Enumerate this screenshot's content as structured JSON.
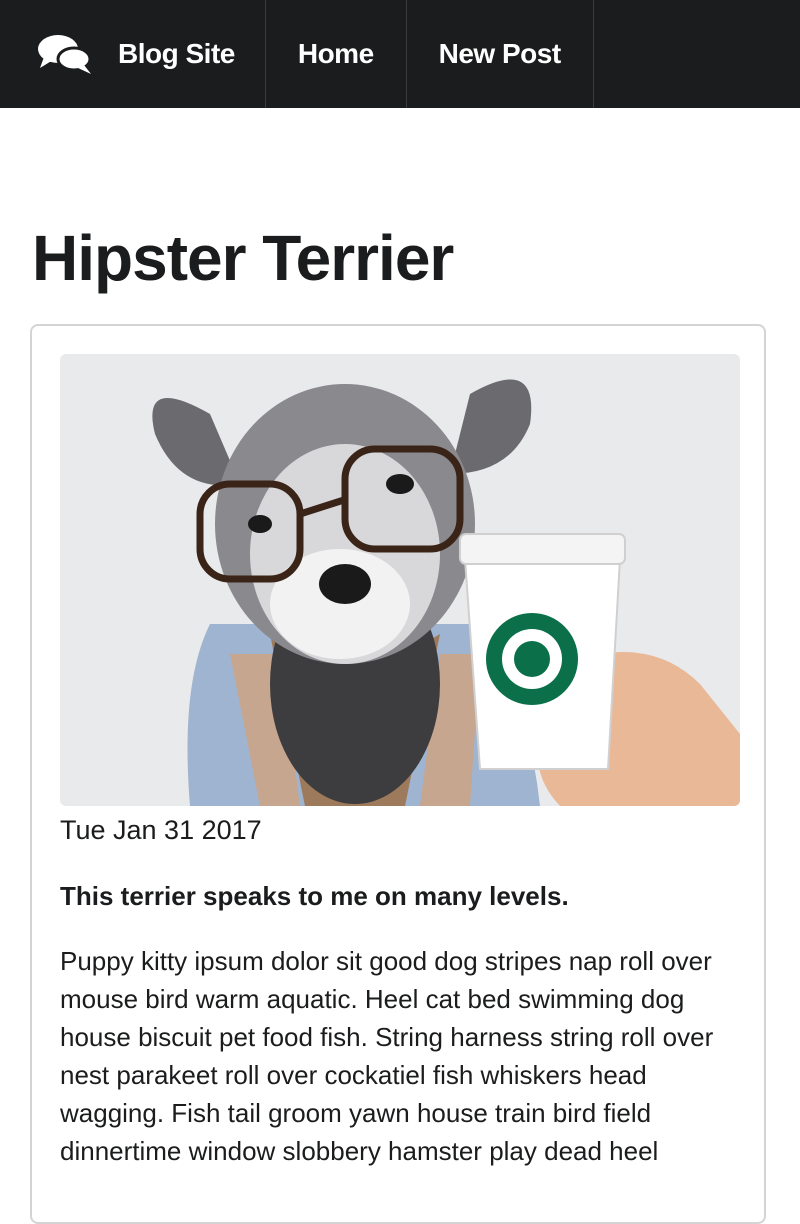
{
  "navbar": {
    "brand": {
      "icon": "comments-icon",
      "label": "Blog Site"
    },
    "items": [
      {
        "label": "Home"
      },
      {
        "label": "New Post"
      }
    ],
    "background": "#1b1c1d"
  },
  "post": {
    "title": "Hipster Terrier",
    "image": {
      "subject": "terrier wearing glasses with coffee cup"
    },
    "date": "Tue Jan 31 2017",
    "summary": "This terrier speaks to me on many levels.",
    "body": "Puppy kitty ipsum dolor sit good dog stripes nap roll over mouse bird warm aquatic. Heel cat bed swimming dog house biscuit pet food fish. String harness string roll over nest parakeet roll over cockatiel fish whiskers head wagging. Fish tail groom yawn house train bird field dinnertime window slobbery hamster play dead heel"
  }
}
